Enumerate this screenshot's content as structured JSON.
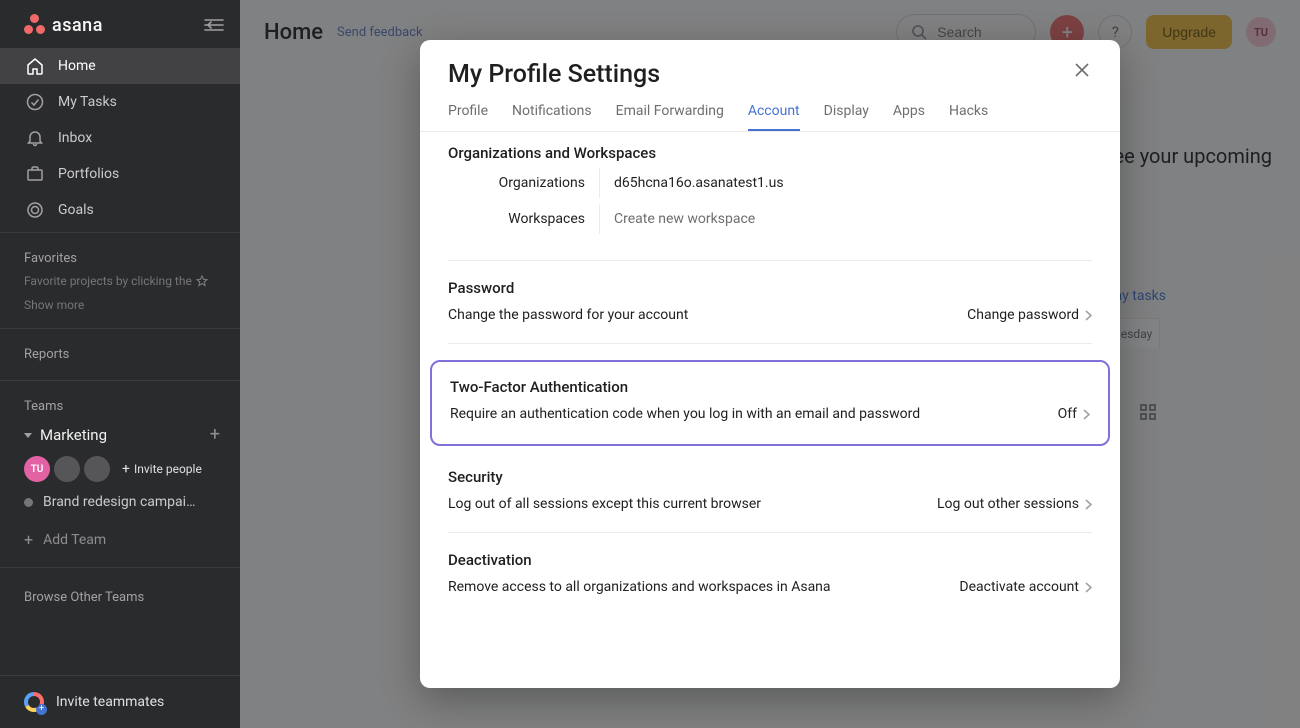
{
  "brand": {
    "name": "asana"
  },
  "sidebar": {
    "items": [
      {
        "label": "Home"
      },
      {
        "label": "My Tasks"
      },
      {
        "label": "Inbox"
      },
      {
        "label": "Portfolios"
      },
      {
        "label": "Goals"
      }
    ],
    "favorites_label": "Favorites",
    "favorites_hint": "Favorite projects by clicking the",
    "show_more": "Show more",
    "reports_label": "Reports",
    "teams_label": "Teams",
    "team_name": "Marketing",
    "invite_people": "Invite people",
    "project_name": "Brand redesign campai…",
    "add_team": "Add Team",
    "browse_label": "Browse Other Teams",
    "invite_teammates": "Invite teammates",
    "avatar_initials": "TU"
  },
  "topbar": {
    "page_title": "Home",
    "feedback": "Send feedback",
    "search_placeholder": "Search",
    "upgrade": "Upgrade",
    "avatar_initials": "TU"
  },
  "main": {
    "upcoming_fragment": "ckly see your upcoming",
    "see_all": "See all my tasks",
    "day_label": "Tuesday"
  },
  "modal": {
    "title": "My Profile Settings",
    "tabs": [
      "Profile",
      "Notifications",
      "Email Forwarding",
      "Account",
      "Display",
      "Apps",
      "Hacks"
    ],
    "active_tab": 3,
    "org_section": {
      "title": "Organizations and Workspaces",
      "org_label": "Organizations",
      "org_value": "d65hcna16o.asanatest1.us",
      "ws_label": "Workspaces",
      "ws_action": "Create new workspace"
    },
    "password_section": {
      "title": "Password",
      "desc": "Change the password for your account",
      "action": "Change password"
    },
    "twofa_section": {
      "title": "Two-Factor Authentication",
      "desc": "Require an authentication code when you log in with an email and password",
      "status": "Off"
    },
    "security_section": {
      "title": "Security",
      "desc": "Log out of all sessions except this current browser",
      "action": "Log out other sessions"
    },
    "deactivation_section": {
      "title": "Deactivation",
      "desc": "Remove access to all organizations and workspaces in Asana",
      "action": "Deactivate account"
    }
  }
}
